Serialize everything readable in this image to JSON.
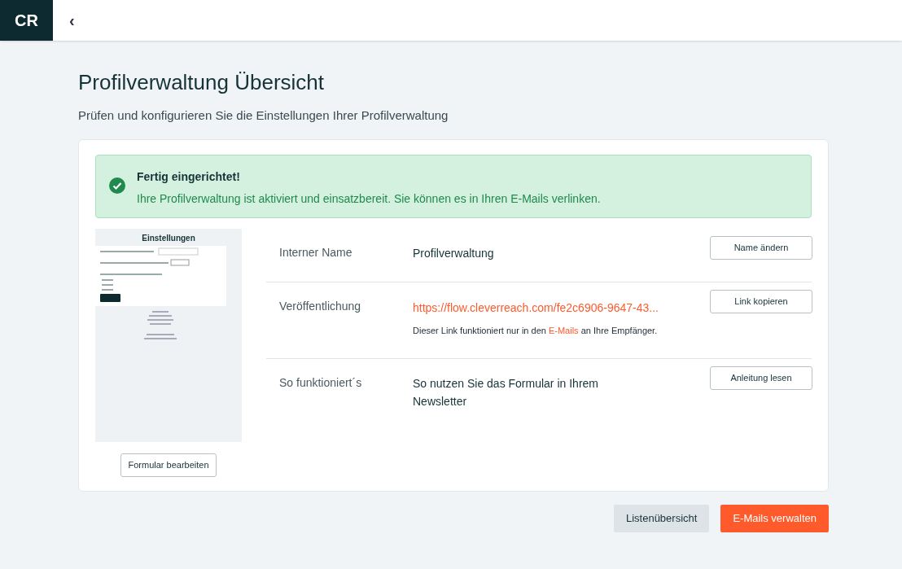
{
  "header": {
    "logo": "CR",
    "back": "‹"
  },
  "page": {
    "title": "Profilverwaltung Übersicht",
    "subtitle": "Prüfen und konfigurieren Sie die Einstellungen Ihrer Profilverwaltung"
  },
  "alert": {
    "kind": "success",
    "title": "Fertig eingerichtet!",
    "message": "Ihre Profilverwaltung ist aktiviert und einsatzbereit. Sie können es in Ihren E-Mails verlinken."
  },
  "preview": {
    "heading": "Einstellungen",
    "edit_button": "Formular bearbeiten"
  },
  "rows": [
    {
      "label": "Interner Name",
      "kind": "text",
      "value": "Profilverwaltung",
      "button": "Name ändern"
    },
    {
      "label": "Veröffentlichung",
      "kind": "link",
      "value": "https://flow.cleverreach.com/fe2c6906-9647-43...",
      "note": "Dieser Link funktioniert nur in den *E-Mails* an Ihre Empfänger.",
      "button": "Link kopieren"
    },
    {
      "label": "So funktioniert´s",
      "kind": "text",
      "value": "So nutzen Sie das Formular in Ihrem Newsletter",
      "button": "Anleitung lesen"
    }
  ],
  "footer_buttons": [
    {
      "label": "Listenübersicht",
      "kind": "secondary"
    },
    {
      "label": "E-Mails verwalten",
      "kind": "primary"
    }
  ]
}
